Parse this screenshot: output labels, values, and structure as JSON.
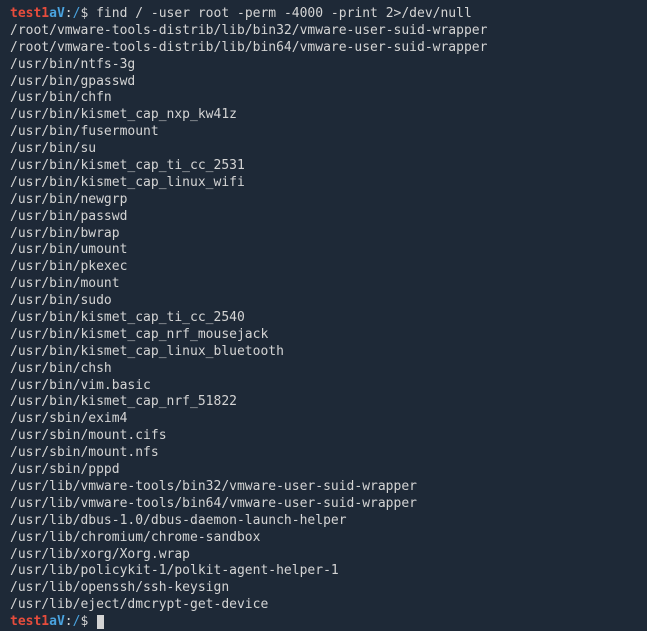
{
  "prompt1": {
    "user": "test1",
    "at": "aV",
    "sep": ":",
    "path": "/",
    "sigil": "$",
    "command": "find / -user root -perm -4000 -print 2>/dev/null"
  },
  "output_lines": [
    "/root/vmware-tools-distrib/lib/bin32/vmware-user-suid-wrapper",
    "/root/vmware-tools-distrib/lib/bin64/vmware-user-suid-wrapper",
    "/usr/bin/ntfs-3g",
    "/usr/bin/gpasswd",
    "/usr/bin/chfn",
    "/usr/bin/kismet_cap_nxp_kw41z",
    "/usr/bin/fusermount",
    "/usr/bin/su",
    "/usr/bin/kismet_cap_ti_cc_2531",
    "/usr/bin/kismet_cap_linux_wifi",
    "/usr/bin/newgrp",
    "/usr/bin/passwd",
    "/usr/bin/bwrap",
    "/usr/bin/umount",
    "/usr/bin/pkexec",
    "/usr/bin/mount",
    "/usr/bin/sudo",
    "/usr/bin/kismet_cap_ti_cc_2540",
    "/usr/bin/kismet_cap_nrf_mousejack",
    "/usr/bin/kismet_cap_linux_bluetooth",
    "/usr/bin/chsh",
    "/usr/bin/vim.basic",
    "/usr/bin/kismet_cap_nrf_51822",
    "/usr/sbin/exim4",
    "/usr/sbin/mount.cifs",
    "/usr/sbin/mount.nfs",
    "/usr/sbin/pppd",
    "/usr/lib/vmware-tools/bin32/vmware-user-suid-wrapper",
    "/usr/lib/vmware-tools/bin64/vmware-user-suid-wrapper",
    "/usr/lib/dbus-1.0/dbus-daemon-launch-helper",
    "/usr/lib/chromium/chrome-sandbox",
    "/usr/lib/xorg/Xorg.wrap",
    "/usr/lib/policykit-1/polkit-agent-helper-1",
    "/usr/lib/openssh/ssh-keysign",
    "/usr/lib/eject/dmcrypt-get-device"
  ],
  "prompt2": {
    "user": "test1",
    "at": "aV",
    "sep": ":",
    "path": "/",
    "sigil": "$",
    "command": ""
  }
}
